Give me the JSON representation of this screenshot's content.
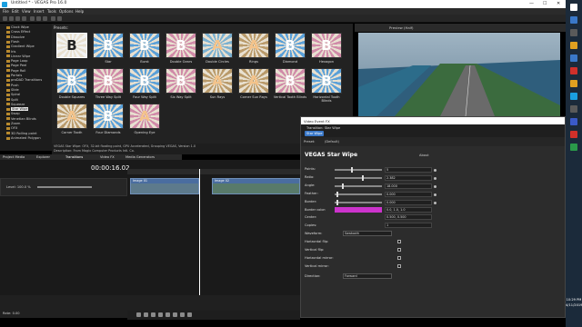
{
  "window": {
    "title": "Untitled * - VEGAS Pro 16.0",
    "controls": [
      "—",
      "☐",
      "✕"
    ]
  },
  "menu": [
    "File",
    "Edit",
    "View",
    "Insert",
    "Tools",
    "Options",
    "Help"
  ],
  "tree": {
    "items": [
      "Clock Wipe",
      "Cross Effect",
      "Dissolve",
      "Flash",
      "Gradient Wipe",
      "Iris",
      "Linear Wipe",
      "Page Loop",
      "Page Peel",
      "Page Roll",
      "Portals",
      "proDAD Transitions",
      "Push",
      "Slide",
      "Spiral",
      "Split",
      "Squeeze",
      "Star Wipe",
      "Swap",
      "Venetian Blinds",
      "Zoom",
      "OFX",
      "3D Rolling point",
      "Animated Polygon"
    ],
    "selected_index": 17
  },
  "presets": {
    "header": "Presets:",
    "items": [
      {
        "name": "",
        "glyph": "B",
        "bg": "#f2f2f2",
        "fg": "#222",
        "selected": true
      },
      {
        "name": "Star",
        "glyph": "B",
        "bg": "#5aa0d8",
        "fg": "#fff"
      },
      {
        "name": "Burst",
        "glyph": "B",
        "bg": "#5aa0d8",
        "fg": "#fff"
      },
      {
        "name": "Double Gears",
        "glyph": "B",
        "bg": "#d08aa8",
        "fg": "#fff"
      },
      {
        "name": "Double Circles",
        "glyph": "A",
        "bg": "#7ab0d0",
        "fg": "#f4c38a"
      },
      {
        "name": "Rings",
        "glyph": "A",
        "bg": "#b99a6a",
        "fg": "#f4c38a"
      },
      {
        "name": "Diamond",
        "glyph": "B",
        "bg": "#5aa0d8",
        "fg": "#fff"
      },
      {
        "name": "Hexagon",
        "glyph": "B",
        "bg": "#d08aa8",
        "fg": "#fff"
      },
      {
        "name": "Double Squares",
        "glyph": "B",
        "bg": "#5aa0d8",
        "fg": "#fff"
      },
      {
        "name": "Three Way Split",
        "glyph": "B",
        "bg": "#d08aa8",
        "fg": "#fff"
      },
      {
        "name": "Four Way Split",
        "glyph": "B",
        "bg": "#5aa0d8",
        "fg": "#fff"
      },
      {
        "name": "Six Way Split",
        "glyph": "B",
        "bg": "#d08aa8",
        "fg": "#fff"
      },
      {
        "name": "Sun Rays",
        "glyph": "A",
        "bg": "#b99a6a",
        "fg": "#f4c38a"
      },
      {
        "name": "Corner Sun Rays",
        "glyph": "A",
        "bg": "#b99a6a",
        "fg": "#f4c38a"
      },
      {
        "name": "Vertical Tooth Blinds",
        "glyph": "B",
        "bg": "#d08aa8",
        "fg": "#fff"
      },
      {
        "name": "Horizontal Tooth Blinds",
        "glyph": "B",
        "bg": "#5aa0d8",
        "fg": "#fff"
      },
      {
        "name": "Corner Tooth",
        "glyph": "A",
        "bg": "#b99a6a",
        "fg": "#f4c38a"
      },
      {
        "name": "Four Diamonds",
        "glyph": "B",
        "bg": "#5aa0d8",
        "fg": "#fff"
      },
      {
        "name": "Opening Eye",
        "glyph": "A",
        "bg": "#d08aa8",
        "fg": "#f4c38a"
      }
    ]
  },
  "info": {
    "line1": "VEGAS Star Wipe: OFX, 32-bit floating point, GPU Accelerated, Grouping VEGAS, Version 1.0",
    "line2": "Description: From Magix Computer Products Intl. Co."
  },
  "left_tabs": [
    "Project Media",
    "Explorer",
    "Transitions",
    "Video FX",
    "Media Generators"
  ],
  "preview": {
    "label": "Preview (Half)"
  },
  "timeline": {
    "timecode": "00:00:16.02",
    "track_level": "Level: 100.0 %",
    "clips": [
      "Image 01",
      "Image 02"
    ],
    "rate": "Rate: 0.00"
  },
  "vefx": {
    "title": "Video Event FX",
    "chain_label": "Transition: Star Wipe",
    "chip": "Star Wipe",
    "preset_label": "Preset:",
    "preset_value": "(Default)",
    "plugin_name": "VEGAS Star Wipe",
    "about": "About",
    "params": [
      {
        "label": "Points:",
        "value": "5"
      },
      {
        "label": "Ratio:",
        "value": "2.382"
      },
      {
        "label": "Angle:",
        "value": "18.000"
      },
      {
        "label": "Feather:",
        "value": "0.000"
      },
      {
        "label": "Border:",
        "value": "0.000"
      }
    ],
    "border_color_label": "Border color:",
    "border_color_value": "0.0, 1.0, 1.0",
    "border_color": "#cc33cc",
    "center_label": "Center:",
    "center_value": "0.500, 0.500",
    "copies_label": "Copies:",
    "copies_value": "1",
    "waveform_label": "Waveform:",
    "waveform_value": "Sawtooth",
    "checkboxes": [
      "Horizontal flip:",
      "Vertical flip:",
      "Horizontal mirror:",
      "Vertical mirror:"
    ],
    "direction_label": "Direction:",
    "direction_value": "Forward"
  },
  "tray": {
    "time": "10:29 PM",
    "date": "4/11/2019"
  }
}
